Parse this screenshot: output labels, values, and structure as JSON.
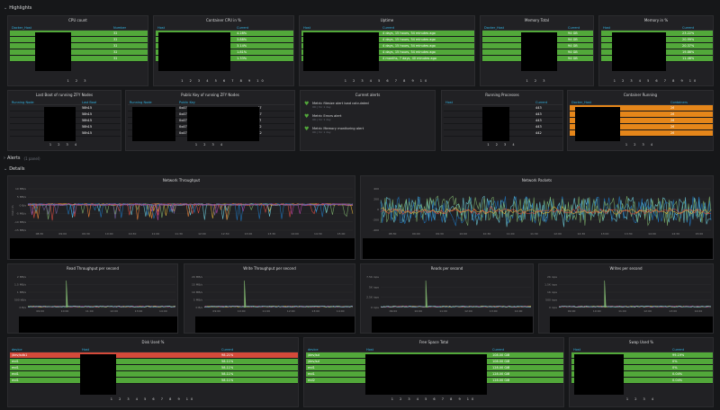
{
  "rows": {
    "highlights": "Highlights",
    "alerts": "Alerts",
    "alerts_sub": "(1 panel)",
    "details": "Details"
  },
  "cpu": {
    "title": "CPU count",
    "cols": [
      "Docker_Host",
      "Number"
    ],
    "values": [
      "32",
      "32",
      "32",
      "32",
      "32"
    ],
    "pager": "1 2 3"
  },
  "container_cpu": {
    "title": "Container CPU in %",
    "cols": [
      "Host",
      "Current"
    ],
    "values": [
      "4.28%",
      "3.88%",
      "3.14%",
      "1.81%",
      "1.33%"
    ],
    "pager": "1 2 3 4 5 6 7 8 9 10"
  },
  "uptime": {
    "title": "Uptime",
    "cols": [
      "Host",
      "Current"
    ],
    "values": [
      "4 days, 15 hours, 54 minutes ago",
      "4 days, 15 hours, 54 minutes ago",
      "4 days, 15 hours, 54 minutes ago",
      "4 days, 15 hours, 54 minutes ago",
      "4 months, 7 days, 40 minutes ago"
    ],
    "pager": "1 2 3 4 5 6 7 8 9 10"
  },
  "mem_total": {
    "title": "Memory Total",
    "cols": [
      "Docker_Host",
      "Current"
    ],
    "values": [
      "94 GB",
      "94 GB",
      "94 GB",
      "94 GB",
      "94 GB"
    ],
    "pager": "1 2 3"
  },
  "mem_pct": {
    "title": "Memory in %",
    "cols": [
      "Host",
      "Current"
    ],
    "values": [
      "23.22%",
      "20.99%",
      "20.37%",
      "19.86%",
      "11.46%"
    ],
    "pager": "1 2 3 4 5 6 7 8 9 10"
  },
  "last_boot": {
    "title": "Last Boot of running ZFY Nodes",
    "cols": [
      "Running Node",
      "Last Boot"
    ],
    "values": [
      "58h15",
      "58h15",
      "58h15",
      "58h15",
      "58h15"
    ],
    "pager": "1 2 3 4"
  },
  "public_key": {
    "title": "Public Key of running ZFY Nodes",
    "cols": [
      "Running Node",
      "Public Key"
    ],
    "keys": [
      "0x47",
      "0x47",
      "0x47",
      "0x47",
      "0x47"
    ],
    "ends": [
      "a47",
      "b47",
      "c47",
      "a12",
      "b12"
    ],
    "pager": "1 2 3 4"
  },
  "alerts_panel": {
    "title": "Current alerts",
    "items": [
      {
        "text": "Metric filesize alert load calculated",
        "sub": "OK | for 1 day"
      },
      {
        "text": "Metric Errors alert",
        "sub": "OK | for 1 day"
      },
      {
        "text": "Metric Memory monitoring alert",
        "sub": "OK | for 1 day"
      }
    ]
  },
  "running_proc": {
    "title": "Running Processes",
    "cols": [
      "Host",
      "Current"
    ],
    "values": [
      "443",
      "443",
      "443",
      "443",
      "442"
    ],
    "pager": "1 2 3 4"
  },
  "container_running": {
    "title": "Container Running",
    "cols": [
      "Docker_Host",
      "Containers"
    ],
    "values": [
      "26",
      "26",
      "26",
      "26",
      "26"
    ],
    "pager": "1 2 3 4"
  },
  "net_throughput": {
    "title": "Network Throughput",
    "yticks": [
      "10 MB/s",
      "5 MB/s",
      "0 B/s",
      "-5 MB/s",
      "-10 MB/s",
      "-15 MB/s"
    ],
    "ylabel": "Out / In",
    "xticks": [
      "08:30",
      "09:00",
      "09:30",
      "10:00",
      "10:30",
      "11:00",
      "11:30",
      "12:00",
      "12:30",
      "13:00",
      "13:30",
      "14:00",
      "14:30",
      "15:00"
    ]
  },
  "net_packets": {
    "title": "Network Packets",
    "yticks": [
      "400",
      "200",
      "0",
      "-200",
      "-400"
    ],
    "xticks": [
      "08:30",
      "09:00",
      "09:30",
      "10:00",
      "10:30",
      "11:00",
      "11:30",
      "12:00",
      "12:30",
      "13:00",
      "13:30",
      "14:00",
      "14:30",
      "15:00"
    ]
  },
  "read_tp": {
    "title": "Read Throughput per second",
    "yticks": [
      "2 MB/s",
      "1.5 MB/s",
      "1 MB/s",
      "500 kB/s",
      "0 B/s"
    ],
    "xticks": [
      "09:00",
      "10:00",
      "11:00",
      "12:00",
      "13:00",
      "14:00"
    ]
  },
  "write_tp": {
    "title": "Write Throughput per second",
    "yticks": [
      "20 MB/s",
      "15 MB/s",
      "10 MB/s",
      "5 MB/s",
      "0 B/s"
    ],
    "xticks": [
      "09:00",
      "10:00",
      "11:00",
      "12:00",
      "13:00",
      "14:00"
    ]
  },
  "reads_ps": {
    "title": "Reads per second",
    "yticks": [
      "7.5K iops",
      "5K iops",
      "2.5K iops",
      "0 iops"
    ],
    "xticks": [
      "09:00",
      "10:00",
      "11:00",
      "12:00",
      "13:00",
      "14:00"
    ]
  },
  "writes_ps": {
    "title": "Writes per second",
    "yticks": [
      "2K iops",
      "1.5K iops",
      "1K iops",
      "500 iops",
      "0 iops"
    ],
    "xticks": [
      "09:00",
      "10:00",
      "11:00",
      "12:00",
      "13:00",
      "14:00"
    ]
  },
  "disk_used": {
    "title": "Disk Used %",
    "cols": [
      "device",
      "Host",
      "Current"
    ],
    "devices": [
      "/dev/sdb1",
      "md1",
      "md1",
      "md1",
      "md1"
    ],
    "values": [
      "98.21%",
      "58.11%",
      "58.11%",
      "58.11%",
      "58.11%"
    ],
    "pager": "1 2 3 4 5 6 7 8 9 10"
  },
  "free_space": {
    "title": "Free Space Total",
    "cols": [
      "device",
      "Host",
      "Current"
    ],
    "devices": [
      "/dev/sd",
      "/dev/sd",
      "md1",
      "md1",
      "md2"
    ],
    "values": [
      "108.00 GiB",
      "108.00 GiB",
      "128.00 GiB",
      "128.00 GiB",
      "128.00 GiB"
    ],
    "pager": "1 2 3 4 5 6 7 8 9 10"
  },
  "swap_used": {
    "title": "Swap Used %",
    "cols": [
      "Host",
      "Current"
    ],
    "values": [
      "99.19%",
      "0%",
      "0%",
      "0.04%",
      "0.04%"
    ],
    "pager": "1 2 3 4"
  }
}
